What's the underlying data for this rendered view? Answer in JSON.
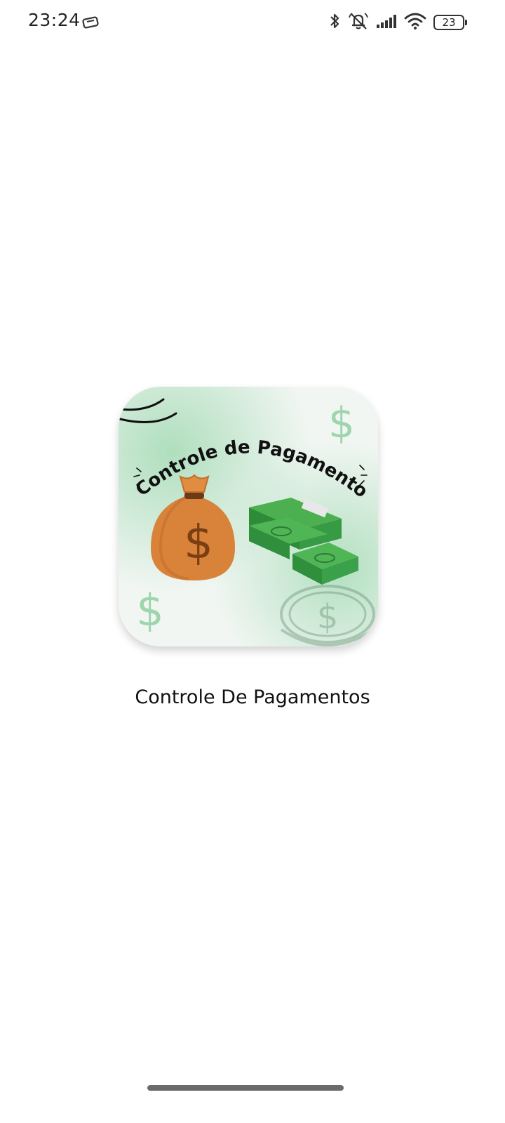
{
  "status_bar": {
    "time": "23:24",
    "battery_level": "23",
    "icons": [
      "cast-icon",
      "bluetooth-icon",
      "mute-bell-icon",
      "signal-icon",
      "wifi-icon",
      "battery-icon"
    ]
  },
  "splash": {
    "app_name": "Controle De Pagamentos",
    "icon_title": "Controle de Pagamento",
    "icon_elements": [
      "money-bag-icon",
      "cash-stack-icon",
      "dollar-sign-icon",
      "coin-icon"
    ]
  },
  "colors": {
    "bag_orange": "#d9823a",
    "cash_green": "#3aa14a",
    "watercolor_green": "#9fd8b0"
  }
}
